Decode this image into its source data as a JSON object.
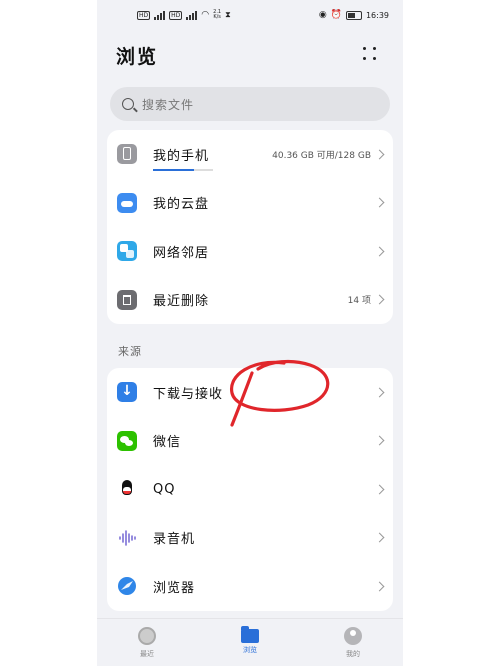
{
  "status_bar": {
    "sim1": "HD",
    "sim2": "HD",
    "speed_value": "2.1",
    "speed_unit": "K/s",
    "time": "16:39"
  },
  "header": {
    "title": "浏览",
    "more_icon": "more-dots-icon"
  },
  "search": {
    "placeholder": "搜索文件"
  },
  "storage_card": [
    {
      "label": "我的手机",
      "meta": "40.36 GB 可用/128 GB",
      "icon": "phone-icon",
      "storage_used": 0.68
    },
    {
      "label": "我的云盘",
      "meta": "",
      "icon": "cloud-icon"
    },
    {
      "label": "网络邻居",
      "meta": "",
      "icon": "network-icon"
    },
    {
      "label": "最近删除",
      "meta": "14 项",
      "icon": "trash-icon"
    }
  ],
  "sources": {
    "section_label": "来源",
    "items": [
      {
        "label": "下载与接收",
        "icon": "download-icon"
      },
      {
        "label": "微信",
        "icon": "wechat-icon"
      },
      {
        "label": "QQ",
        "icon": "qq-icon"
      },
      {
        "label": "录音机",
        "icon": "recorder-icon"
      },
      {
        "label": "浏览器",
        "icon": "browser-icon"
      }
    ]
  },
  "bottom_nav": [
    {
      "label": "最近",
      "icon": "clock-icon",
      "active": false
    },
    {
      "label": "浏览",
      "icon": "folder-icon",
      "active": true
    },
    {
      "label": "我的",
      "icon": "person-icon",
      "active": false
    }
  ],
  "colors": {
    "accent": "#2a6fd8",
    "annotation": "#e0262b",
    "background": "#f1f2f6"
  }
}
